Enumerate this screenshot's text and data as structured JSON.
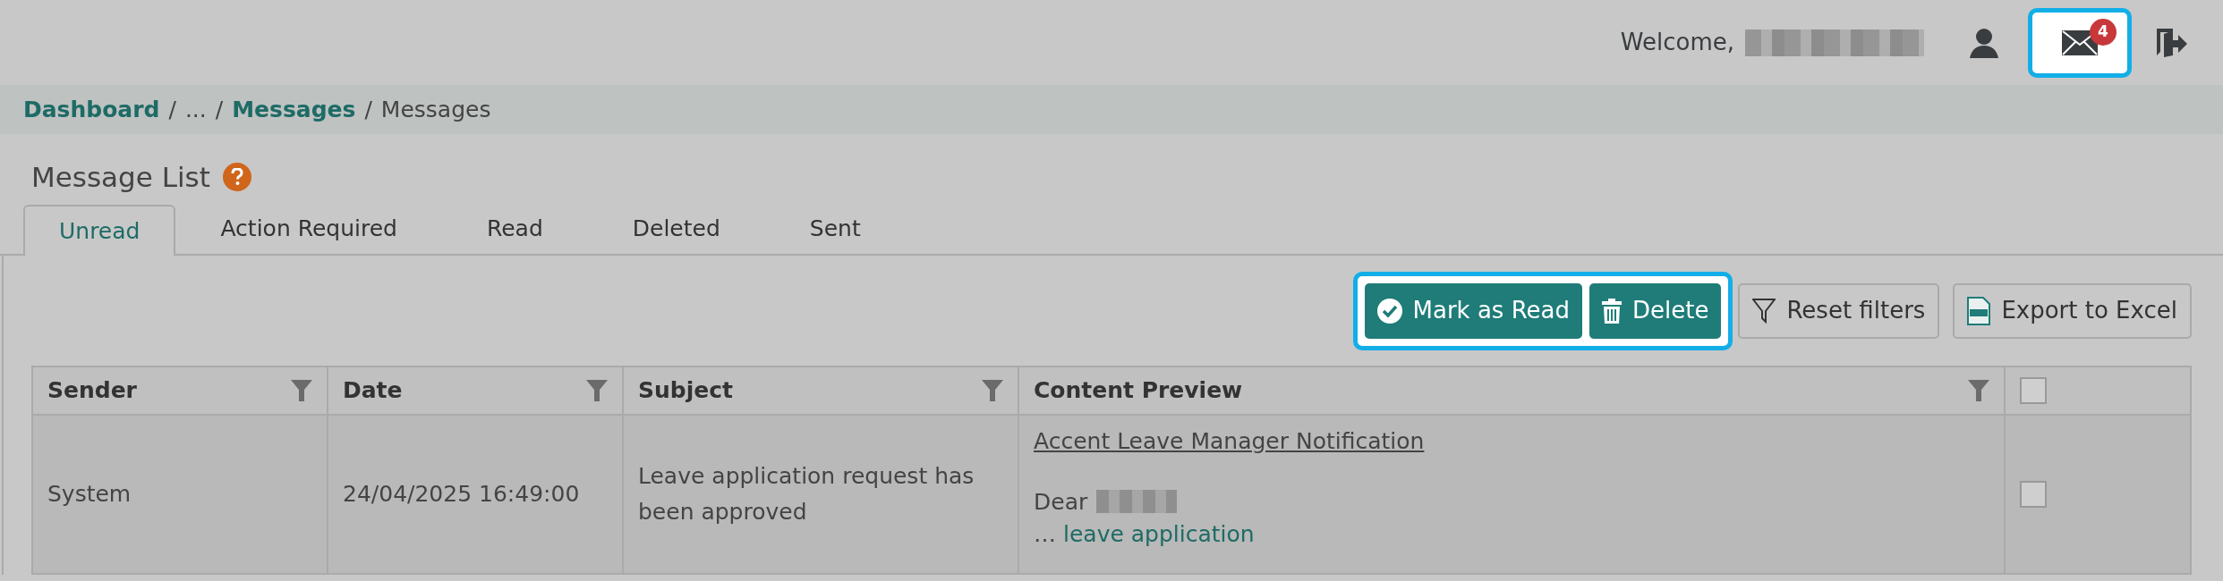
{
  "header": {
    "welcome": "Welcome,",
    "notification_count": "4"
  },
  "breadcrumb": [
    {
      "label": "Dashboard",
      "kind": "link"
    },
    {
      "label": "/",
      "kind": "separator"
    },
    {
      "label": "...",
      "kind": "text"
    },
    {
      "label": "/",
      "kind": "separator"
    },
    {
      "label": "Messages",
      "kind": "link"
    },
    {
      "label": "/",
      "kind": "separator"
    },
    {
      "label": "Messages",
      "kind": "text"
    }
  ],
  "title": "Message List",
  "tabs": [
    {
      "label": "Unread",
      "selected": true
    },
    {
      "label": "Action Required",
      "selected": false
    },
    {
      "label": "Read",
      "selected": false
    },
    {
      "label": "Deleted",
      "selected": false
    },
    {
      "label": "Sent",
      "selected": false
    }
  ],
  "toolbar": [
    {
      "label": "Mark as Read",
      "kind": "primary"
    },
    {
      "label": "Delete",
      "kind": "primary"
    },
    {
      "label": "Reset filters",
      "kind": "secondary"
    },
    {
      "label": "Export to Excel",
      "kind": "secondary"
    }
  ],
  "table": {
    "columns": [
      "Sender",
      "Date",
      "Subject",
      "Content Preview"
    ],
    "header_checked": false,
    "rows": [
      {
        "sender": "System",
        "date": "24/04/2025 16:49:00",
        "subject": "Leave application request has been approved",
        "preview_title": "Accent Leave Manager Notification",
        "preview_greeting": "Dear",
        "preview_ellipsis": "…",
        "preview_link": "leave application",
        "checked": false
      }
    ]
  }
}
